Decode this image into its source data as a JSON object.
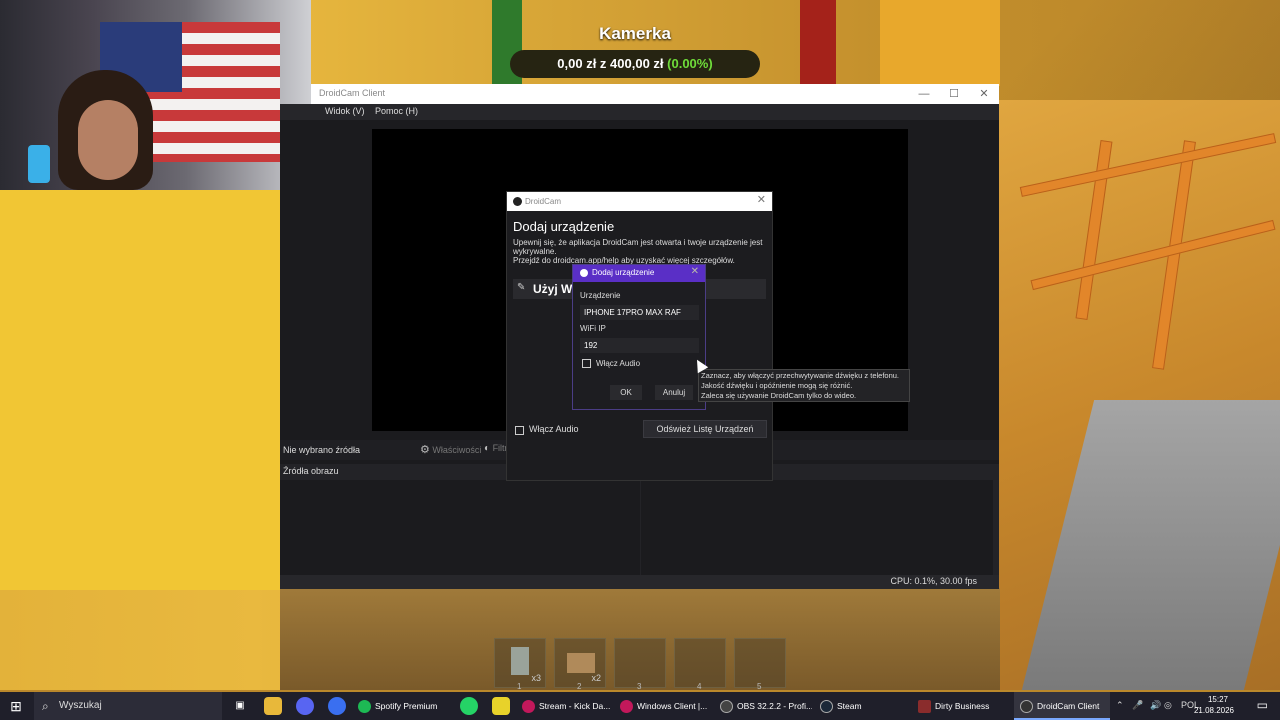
{
  "overlay": {
    "title": "Kamerka",
    "goal_amount": "0,00 zł z 400,00 zł",
    "goal_percent": "(0.00%)"
  },
  "app_window": {
    "title": "DroidCam Client",
    "menu": [
      "Widok (V)",
      "Pomoc (H)"
    ]
  },
  "obs": {
    "source_label": "Nie wybrano źródła",
    "properties_label": "Właściwości",
    "filters_label": "Filtry",
    "dock_header": "Źródła obrazu",
    "status": "CPU: 0.1%, 30.00 fps"
  },
  "dialog": {
    "window_title": "DroidCam",
    "heading": "Dodaj urządzenie",
    "desc": "Upewnij się, że aplikacja DroidCam jest otwarta i twoje urządzenie jest wykrywalne.",
    "desc2": "Przejdź do droidcam.app/help aby uzyskać więcej szczegółów.",
    "wifi_label": "Użyj WiFi",
    "audio_label": "Włącz Audio",
    "refresh_label": "Odśwież Listę Urządzeń"
  },
  "inner_dialog": {
    "title": "Dodaj urządzenie",
    "device_label": "Urządzenie",
    "device_value": "IPHONE 17PRO MAX RAF",
    "ip_label": "WiFi IP",
    "ip_value": "192",
    "audio_label": "Włącz Audio",
    "ok_label": "OK",
    "cancel_label": "Anuluj"
  },
  "tooltip": {
    "line1": "Zaznacz, aby włączyć przechwytywanie dźwięku z telefonu.",
    "line2": "Jakość dźwięku i opóźnienie mogą się różnić.",
    "line3": "Zaleca się używanie DroidCam tylko do wideo."
  },
  "hotbar": {
    "slots": [
      {
        "num": "1",
        "count": "x3"
      },
      {
        "num": "2",
        "count": "x2"
      },
      {
        "num": "3",
        "count": ""
      },
      {
        "num": "4",
        "count": ""
      },
      {
        "num": "5",
        "count": ""
      }
    ]
  },
  "taskbar": {
    "search_placeholder": "Wyszukaj",
    "apps": [
      {
        "label": "Spotify Premium",
        "color": "#1db954"
      },
      {
        "label": "Stream - Kick Da...",
        "color": "#c2185b"
      },
      {
        "label": "Windows Client |...",
        "color": "#c2185b"
      },
      {
        "label": "OBS 32.2.2 - Profi...",
        "color": "#444"
      },
      {
        "label": "Steam",
        "color": "#1b2838"
      },
      {
        "label": "Dirty Business",
        "color": "#8a2c2c"
      },
      {
        "label": "DroidCam Client",
        "color": "#333"
      }
    ],
    "language": "POL",
    "time": "15:27",
    "date": "21.08.2026"
  },
  "colors": {
    "accent_purple": "#5a2fc6",
    "goal_green": "#6fdc3a"
  }
}
